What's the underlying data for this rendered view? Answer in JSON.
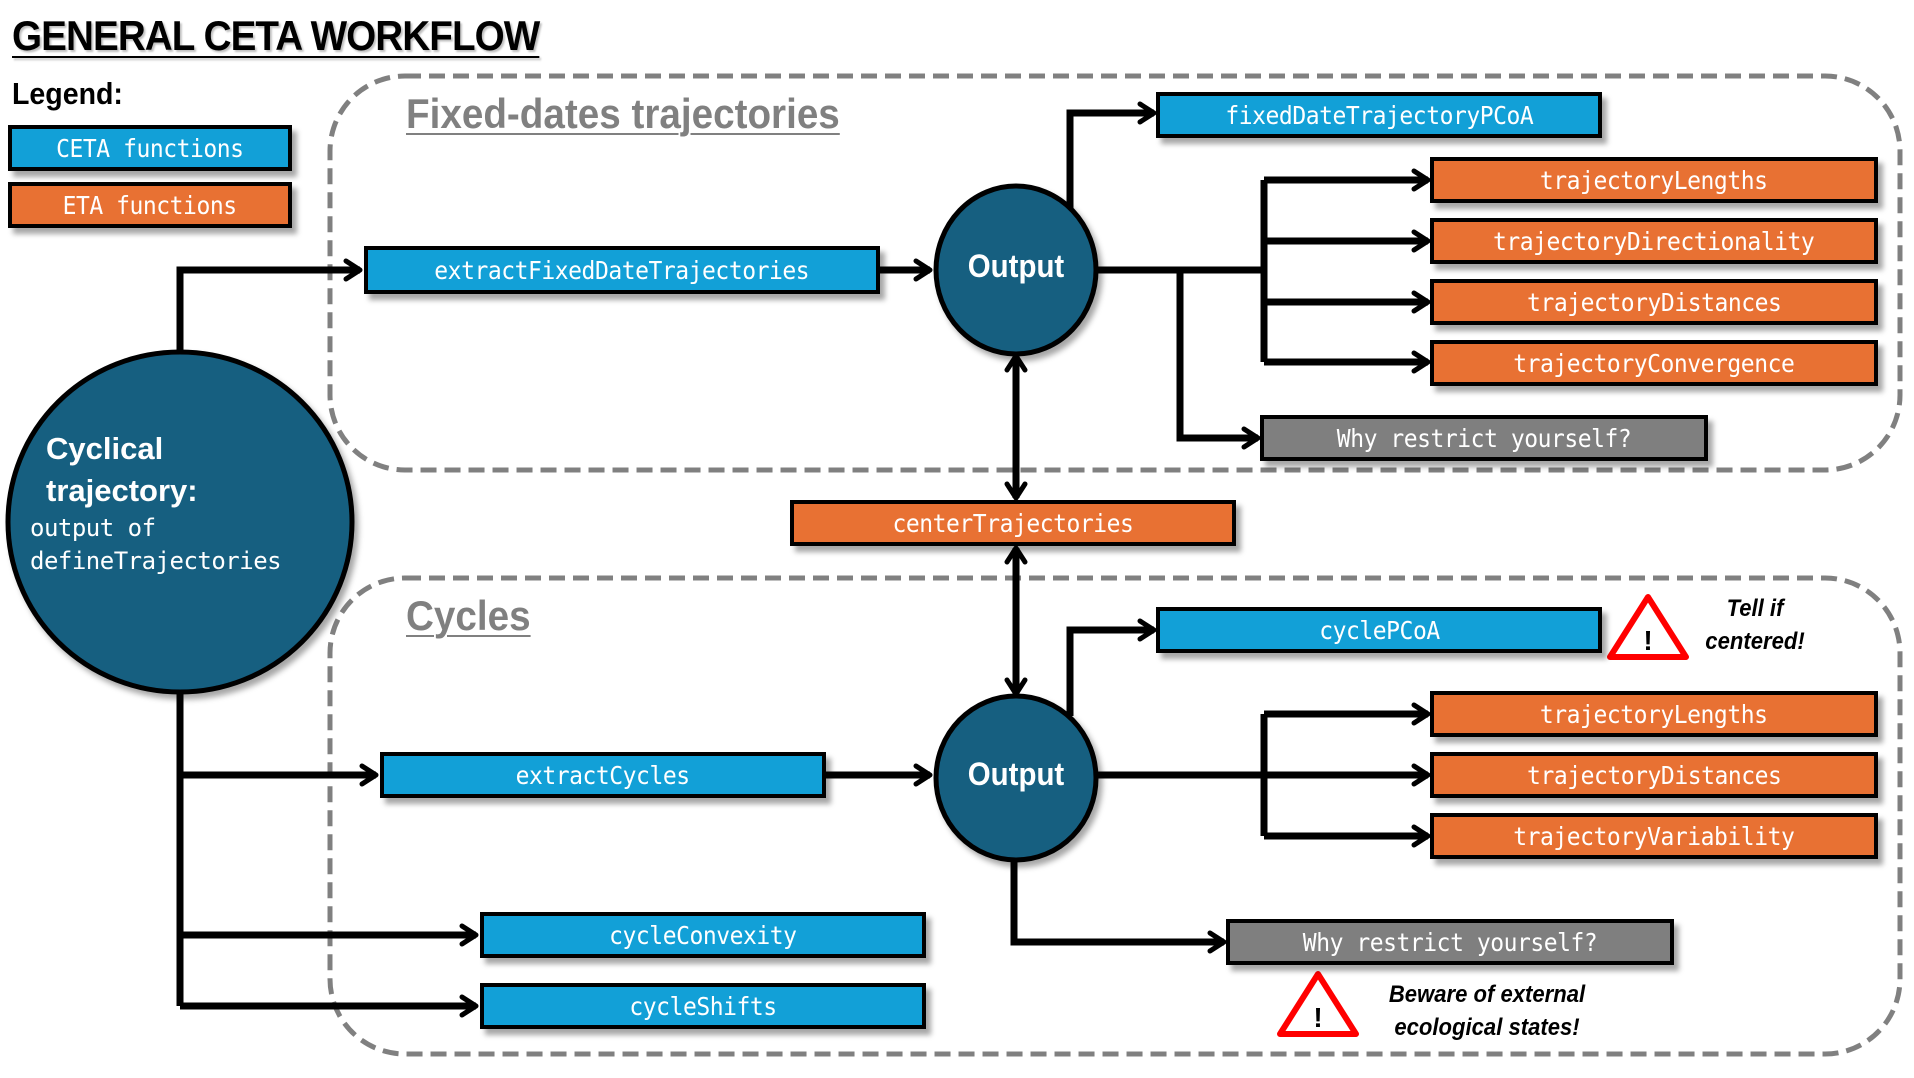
{
  "title": "GENERAL CETA WORKFLOW",
  "legend": {
    "label": "Legend:",
    "items": [
      {
        "label": "CETA functions",
        "color": "#12a0d7"
      },
      {
        "label": "ETA functions",
        "color": "#e87133"
      }
    ]
  },
  "colors": {
    "ceta": "#12a0d7",
    "eta": "#e87133",
    "neutral": "#7f7f7f",
    "node": "#175e80",
    "group_border": "#808080",
    "warning": "#ff0000"
  },
  "source_node": {
    "title_line1": "Cyclical",
    "title_line2": "trajectory:",
    "subtitle_line1": "output of",
    "subtitle_line2": "defineTrajectories"
  },
  "groups": {
    "fixed_dates": {
      "title": "Fixed-dates trajectories",
      "extract_function": "extractFixedDateTrajectories",
      "output_label": "Output",
      "pcoa_function": "fixedDateTrajectoryPCoA",
      "eta_functions": [
        "trajectoryLengths",
        "trajectoryDirectionality",
        "trajectoryDistances",
        "trajectoryConvergence"
      ],
      "other_label": "Why restrict yourself?"
    },
    "cycles": {
      "title": "Cycles",
      "extract_function": "extractCycles",
      "output_label": "Output",
      "pcoa_function": "cyclePCoA",
      "pcoa_warning_line1": "Tell if",
      "pcoa_warning_line2": "centered!",
      "eta_functions": [
        "trajectoryLengths",
        "trajectoryDistances",
        "trajectoryVariability"
      ],
      "other_label": "Why restrict yourself?",
      "other_warning_line1": "Beware of external",
      "other_warning_line2": "ecological states!",
      "direct_functions": [
        "cycleConvexity",
        "cycleShifts"
      ]
    }
  },
  "center_function": "centerTrajectories"
}
